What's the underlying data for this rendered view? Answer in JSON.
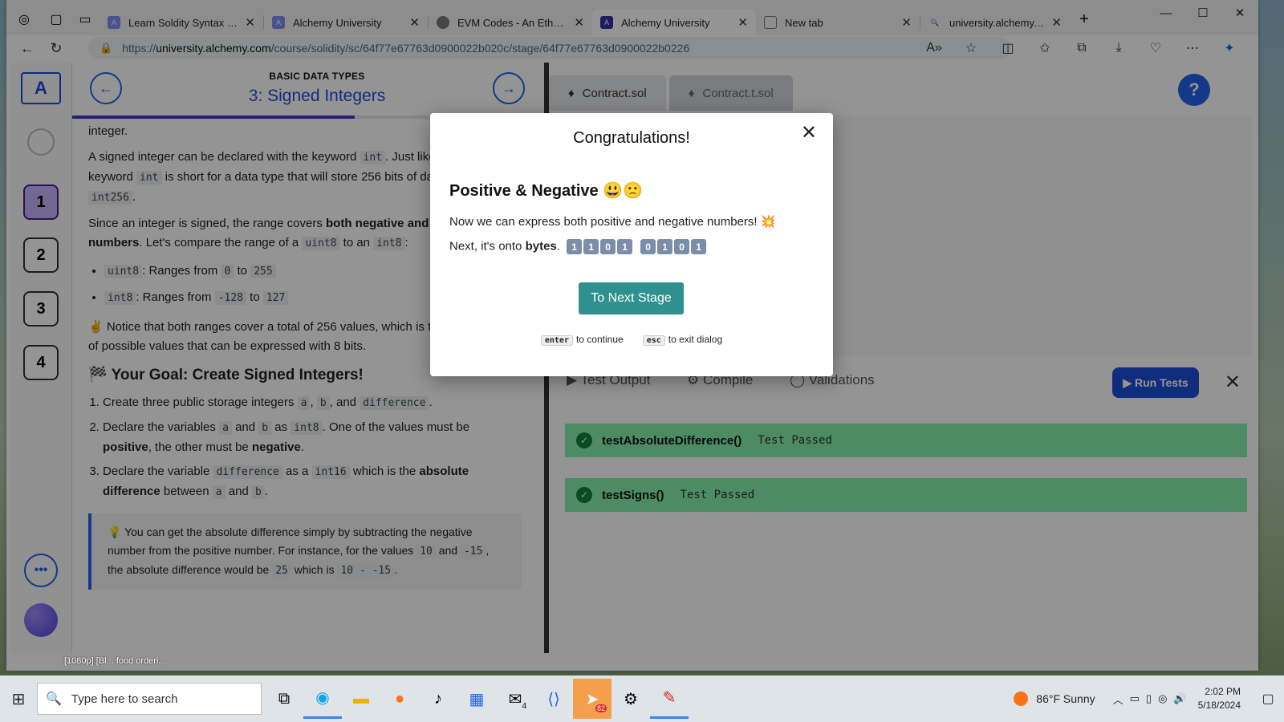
{
  "browser": {
    "tabs": [
      {
        "title": "Learn Soldity Syntax (Free C",
        "active": false
      },
      {
        "title": "Alchemy University",
        "active": false
      },
      {
        "title": "EVM Codes - An Ethereum V",
        "active": false
      },
      {
        "title": "Alchemy University",
        "active": true
      },
      {
        "title": "New tab",
        "active": false
      },
      {
        "title": "university.alchemy.com/co",
        "active": false
      }
    ],
    "url_prefix": "https://",
    "url_host": "university.alchemy.com",
    "url_path": "/course/solidity/sc/64f77e67763d0900022b020c/stage/64f77e67763d0900022b0226"
  },
  "lesson": {
    "breadcrumb": "BASIC DATA TYPES",
    "title": "3: Signed Integers",
    "steps": [
      "1",
      "2",
      "3",
      "4"
    ],
    "p0": "integer.",
    "p1a": "A signed integer can be declared with the keyword ",
    "p1b": ". Just like ",
    "p1c": "keyword ",
    "p1d": " is short for a data type that will store 256 bits of data, ",
    "p1e": ".",
    "kw_int": "int",
    "kw_int256": "int256",
    "p2a": "Since an integer is signed, the range covers ",
    "p2b": "both negative and positive numbers",
    "p2c": ". Let's compare the range of a ",
    "p2d": " to an ",
    "p2e": ":",
    "kw_uint8": "uint8",
    "kw_int8": "int8",
    "li1": ": Ranges from ",
    "li1_from": "0",
    "li_to": " to ",
    "li1_to": "255",
    "li2_from": "-128",
    "li2_to": "127",
    "p3": "✌️ Notice that both ranges cover a total of 256 values, which is the total number of possible values that can be expressed with 8 bits.",
    "goal": "🏁 Your Goal: Create Signed Integers!",
    "g1a": "Create three public storage integers ",
    "g1_a": "a",
    "g1_b": "b",
    "g1_and": ", and ",
    "g1_comma": ", ",
    "g1_diff": "difference",
    "g1_end": ".",
    "g2a": "Declare the variables ",
    "g2b": " and ",
    "g2c": " as ",
    "g2d": ". One of the values must be ",
    "g2e": "positive",
    "g2f": ", the other must be ",
    "g2g": "negative",
    "g3a": "Declare the variable ",
    "g3b": " as a ",
    "kw_int16": "int16",
    "g3c": " which is the ",
    "g3d": "absolute difference",
    "g3e": " between ",
    "tip_a": "💡 You can get the absolute difference simply by subtracting the negative number from the positive number. For instance, for the values ",
    "tip_10": "10",
    "tip_and": " and ",
    "tip_m15": "-15",
    "tip_b": ", the absolute difference would be ",
    "tip_25": "25",
    "tip_c": " which is ",
    "tip_expr": "10 - -15"
  },
  "editor": {
    "file_tabs": [
      "Contract.sol",
      "Contract.t.sol"
    ],
    "help": "?",
    "bottom_tabs": [
      "Test Output",
      "Compile",
      "Validations"
    ],
    "run_tests": "Run Tests",
    "tests": [
      {
        "name": "testAbsoluteDifference()",
        "status": "Test Passed"
      },
      {
        "name": "testSigns()",
        "status": "Test Passed"
      }
    ]
  },
  "modal": {
    "title": "Congratulations!",
    "heading": "Positive & Negative 😃🙁",
    "line1": "Now we can express both positive and negative numbers! 💥",
    "line2a": "Next, it's onto ",
    "line2b": "bytes",
    "line2c": ".",
    "bits": [
      "1",
      "1",
      "0",
      "1",
      "0",
      "1",
      "0",
      "1"
    ],
    "button": "To Next Stage",
    "enter_key": "enter",
    "enter_hint": "to continue",
    "esc_key": "esc",
    "esc_hint": "to exit dialog"
  },
  "desktop": {
    "file_label": "[1080p] [Bl...   food orderi..."
  },
  "taskbar": {
    "search_placeholder": "Type here to search",
    "weather": "86°F  Sunny",
    "time": "2:02 PM",
    "date": "5/18/2024",
    "mail_badge": "4",
    "telegram_badge": "82"
  }
}
